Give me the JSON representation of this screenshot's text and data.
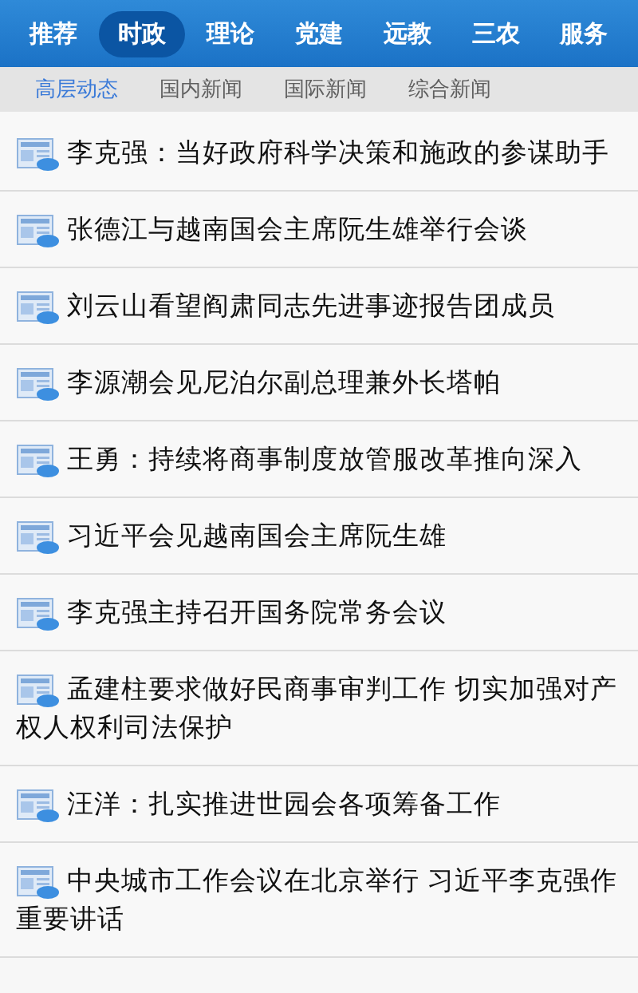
{
  "top_tabs": [
    {
      "label": "推荐",
      "selected": false
    },
    {
      "label": "时政",
      "selected": true
    },
    {
      "label": "理论",
      "selected": false
    },
    {
      "label": "党建",
      "selected": false
    },
    {
      "label": "远教",
      "selected": false
    },
    {
      "label": "三农",
      "selected": false
    },
    {
      "label": "服务",
      "selected": false
    }
  ],
  "sub_tabs": [
    {
      "label": "高层动态",
      "selected": true
    },
    {
      "label": "国内新闻",
      "selected": false
    },
    {
      "label": "国际新闻",
      "selected": false
    },
    {
      "label": "综合新闻",
      "selected": false
    }
  ],
  "news": [
    {
      "title": "李克强：当好政府科学决策和施政的参谋助手"
    },
    {
      "title": "张德江与越南国会主席阮生雄举行会谈"
    },
    {
      "title": "刘云山看望阎肃同志先进事迹报告团成员"
    },
    {
      "title": "李源潮会见尼泊尔副总理兼外长塔帕"
    },
    {
      "title": "王勇：持续将商事制度放管服改革推向深入"
    },
    {
      "title": "习近平会见越南国会主席阮生雄"
    },
    {
      "title": "李克强主持召开国务院常务会议"
    },
    {
      "title": "孟建柱要求做好民商事审判工作 切实加强对产权人权利司法保护"
    },
    {
      "title": "汪洋：扎实推进世园会各项筹备工作"
    },
    {
      "title": "中央城市工作会议在北京举行 习近平李克强作重要讲话"
    }
  ]
}
